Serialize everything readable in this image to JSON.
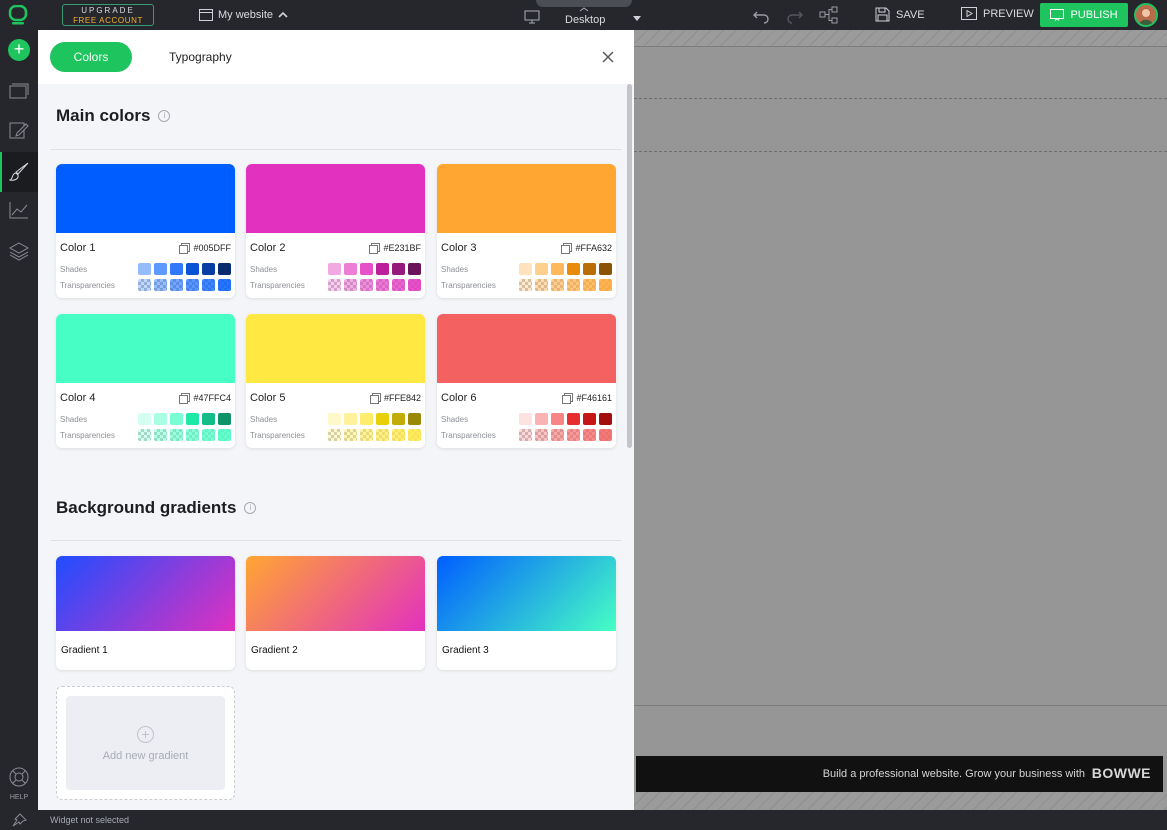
{
  "topbar": {
    "upgrade_line1": "UPGRADE",
    "upgrade_line2": "FREE ACCOUNT",
    "site_name": "My website",
    "device": "Desktop",
    "save_label": "SAVE",
    "preview_label": "PREVIEW",
    "publish_label": "PUBLISH"
  },
  "leftbar": {
    "add_icon": "plus-icon",
    "items": [
      "pages-icon",
      "edit-icon",
      "brush-icon",
      "analytics-icon",
      "layers-icon"
    ],
    "active_item": "brush-icon",
    "help_label": "HELP"
  },
  "panel": {
    "tabs": [
      {
        "label": "Colors",
        "active": true
      },
      {
        "label": "Typography",
        "active": false
      }
    ],
    "main_colors_title": "Main colors",
    "shades_label": "Shades",
    "transparencies_label": "Transparencies",
    "colors": [
      {
        "name": "Color 1",
        "hex": "#005DFF",
        "shades": [
          "#94bcff",
          "#5d99ff",
          "#3079ff",
          "#0a52d6",
          "#083ea3",
          "#082b6e"
        ],
        "transparencies": [
          "rgba(0,93,255,0.25)",
          "rgba(0,93,255,0.4)",
          "rgba(0,93,255,0.55)",
          "rgba(0,93,255,0.65)",
          "rgba(0,93,255,0.75)",
          "rgba(0,93,255,0.85)"
        ]
      },
      {
        "name": "Color 2",
        "hex": "#E231BF",
        "shades": [
          "#f2a9e2",
          "#ec7ed5",
          "#e550c9",
          "#bd1f9c",
          "#951a7b",
          "#6b135a"
        ],
        "transparencies": [
          "rgba(226,49,191,0.25)",
          "rgba(226,49,191,0.4)",
          "rgba(226,49,191,0.55)",
          "rgba(226,49,191,0.65)",
          "rgba(226,49,191,0.75)",
          "rgba(226,49,191,0.85)"
        ]
      },
      {
        "name": "Color 3",
        "hex": "#FFA632",
        "shades": [
          "#ffe3bf",
          "#ffcf8e",
          "#ffb85c",
          "#e88a0a",
          "#b96e08",
          "#8a5306"
        ],
        "transparencies": [
          "rgba(255,166,50,0.25)",
          "rgba(255,166,50,0.4)",
          "rgba(255,166,50,0.55)",
          "rgba(255,166,50,0.65)",
          "rgba(255,166,50,0.75)",
          "rgba(255,166,50,0.85)"
        ]
      },
      {
        "name": "Color 4",
        "hex": "#47FFC4",
        "shades": [
          "#d4fff1",
          "#a8ffe3",
          "#7affd4",
          "#1ee8a8",
          "#14bd88",
          "#0e9468"
        ],
        "transparencies": [
          "rgba(71,255,196,0.25)",
          "rgba(71,255,196,0.4)",
          "rgba(71,255,196,0.55)",
          "rgba(71,255,196,0.65)",
          "rgba(71,255,196,0.75)",
          "rgba(71,255,196,0.85)"
        ]
      },
      {
        "name": "Color 5",
        "hex": "#FFE842",
        "shades": [
          "#fff9c9",
          "#fff29a",
          "#ffec6a",
          "#e8cf0a",
          "#c2ad08",
          "#9a8906"
        ],
        "transparencies": [
          "rgba(255,232,66,0.25)",
          "rgba(255,232,66,0.4)",
          "rgba(255,232,66,0.55)",
          "rgba(255,232,66,0.65)",
          "rgba(255,232,66,0.75)",
          "rgba(255,232,66,0.85)"
        ]
      },
      {
        "name": "Color 6",
        "hex": "#F46161",
        "shades": [
          "#fde2e2",
          "#f9b3b3",
          "#f78585",
          "#e62e2e",
          "#c71616",
          "#a30e0e"
        ],
        "transparencies": [
          "rgba(244,97,97,0.25)",
          "rgba(244,97,97,0.4)",
          "rgba(244,97,97,0.55)",
          "rgba(244,97,97,0.65)",
          "rgba(244,97,97,0.75)",
          "rgba(244,97,97,0.85)"
        ]
      }
    ],
    "gradients_title": "Background gradients",
    "gradients": [
      {
        "name": "Gradient 1",
        "from": "#1f4dff",
        "to": "#e031c0"
      },
      {
        "name": "Gradient 2",
        "from": "#ffa632",
        "to": "#e231bf"
      },
      {
        "name": "Gradient 3",
        "from": "#005dff",
        "to": "#47ffc4"
      }
    ],
    "add_gradient_label": "Add new gradient"
  },
  "canvas": {
    "footer_text": "Build a professional website. Grow your business with",
    "brand": "BOWWE"
  },
  "status": {
    "text": "Widget not selected"
  }
}
